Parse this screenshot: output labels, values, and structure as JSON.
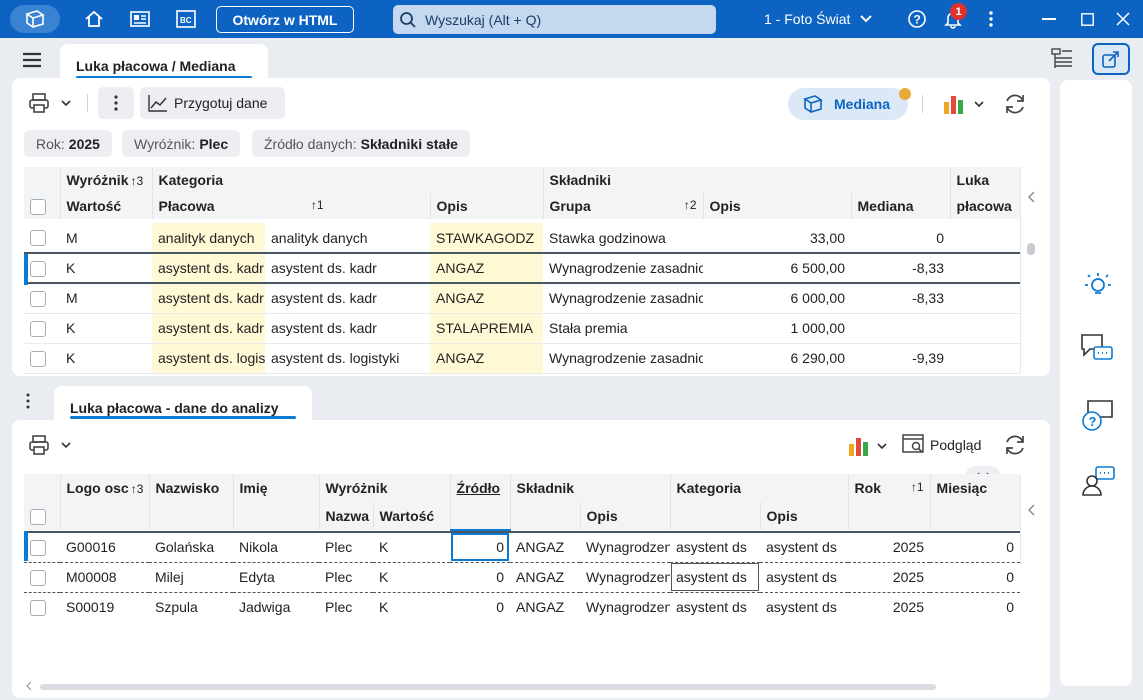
{
  "titlebar": {
    "open_html": "Otwórz w HTML",
    "search_placeholder": "Wyszukaj (Alt + Q)",
    "company": "1 - Foto Świat",
    "notification_count": "1",
    "icons": [
      "app-icon",
      "home-icon",
      "documents-icon",
      "bc-icon",
      "search-icon",
      "chevron-down-icon",
      "help-icon",
      "bell-icon",
      "more-icon",
      "minimize-icon",
      "maximize-icon",
      "close-icon"
    ]
  },
  "tabs": {
    "top": "Luka płacowa / Mediana",
    "bottom": "Luka płacowa - dane do analizy"
  },
  "toolbar1": {
    "prepare": "Przygotuj dane",
    "mediana": "Mediana"
  },
  "chips": [
    {
      "label": "Rok:",
      "value": "2025"
    },
    {
      "label": "Wyróżnik:",
      "value": "Plec"
    },
    {
      "label": "Źródło danych:",
      "value": "Składniki stałe"
    }
  ],
  "grid1": {
    "groups": {
      "wyroznik": "Wyróżnik",
      "kategoria": "Kategoria",
      "skladniki": "Składniki",
      "luka": "Luka"
    },
    "cols": {
      "wartosc": "Wartość",
      "placowa": "Płacowa",
      "opis": "Opis",
      "grupa": "Grupa",
      "opis2": "Opis",
      "mediana": "Mediana",
      "luka": "płacowa"
    },
    "sort": {
      "wyroznik": "↑3",
      "placowa": "↑1",
      "grupa": "↑2"
    },
    "rows": [
      {
        "wartosc": "M",
        "placowa": "analityk danych",
        "opis": "analityk danych",
        "grupa": "STAWKAGODZ",
        "opis2": "Stawka godzinowa",
        "mediana": "33,00",
        "luka": "0"
      },
      {
        "wartosc": "K",
        "placowa": "asystent ds. kadr",
        "opis": "asystent ds. kadr",
        "grupa": "ANGAZ",
        "opis2": "Wynagrodzenie zasadnicze",
        "mediana": "6 500,00",
        "luka": "-8,33"
      },
      {
        "wartosc": "M",
        "placowa": "asystent ds. kadr",
        "opis": "asystent ds. kadr",
        "grupa": "ANGAZ",
        "opis2": "Wynagrodzenie zasadnicze",
        "mediana": "6 000,00",
        "luka": "-8,33"
      },
      {
        "wartosc": "K",
        "placowa": "asystent ds. kadr",
        "opis": "asystent ds. kadr",
        "grupa": "STALAPREMIA",
        "opis2": "Stała premia",
        "mediana": "1 000,00",
        "luka": ""
      },
      {
        "wartosc": "K",
        "placowa": "asystent ds. logistyki",
        "opis": "asystent ds. logistyki",
        "grupa": "ANGAZ",
        "opis2": "Wynagrodzenie zasadnicze",
        "mediana": "6 290,00",
        "luka": "-9,39"
      }
    ]
  },
  "toolbar2": {
    "preview": "Podgląd"
  },
  "grid2": {
    "cols": {
      "logo": "Logo osc",
      "nazwisko": "Nazwisko",
      "imie": "Imię",
      "wyroznik": "Wyróżnik",
      "nazwa": "Nazwa",
      "wartosc": "Wartość",
      "zrodlo": "Źródło",
      "skladnik": "Składnik",
      "opis": "Opis",
      "kategoria": "Kategoria",
      "opis2": "Opis",
      "rok": "Rok",
      "miesiac": "Miesiąc"
    },
    "sort": {
      "logo": "↑3",
      "rok": "↑1"
    },
    "rows": [
      {
        "logo": "G00016",
        "nazwisko": "Golańska",
        "imie": "Nikola",
        "nazwa": "Plec",
        "wartosc": "K",
        "zrodlo": "0",
        "skladnik": "ANGAZ",
        "opis": "Wynagrodzenie",
        "kategoria": "asystent ds",
        "opis2": "asystent ds",
        "rok": "2025",
        "miesiac": "0"
      },
      {
        "logo": "M00008",
        "nazwisko": "Milej",
        "imie": "Edyta",
        "nazwa": "Plec",
        "wartosc": "K",
        "zrodlo": "0",
        "skladnik": "ANGAZ",
        "opis": "Wynagrodzenie",
        "kategoria": "asystent ds",
        "opis2": "asystent ds",
        "rok": "2025",
        "miesiac": "0"
      },
      {
        "logo": "S00019",
        "nazwisko": "Szpula",
        "imie": "Jadwiga",
        "nazwa": "Plec",
        "wartosc": "K",
        "zrodlo": "0",
        "skladnik": "ANGAZ",
        "opis": "Wynagrodzenie",
        "kategoria": "asystent ds",
        "opis2": "asystent ds",
        "rok": "2025",
        "miesiac": "0"
      }
    ]
  },
  "colors": {
    "brand": "#0c63c1",
    "accent": "#0c7bd3",
    "highlight": "#fff9d6",
    "badge": "#e0312b"
  }
}
